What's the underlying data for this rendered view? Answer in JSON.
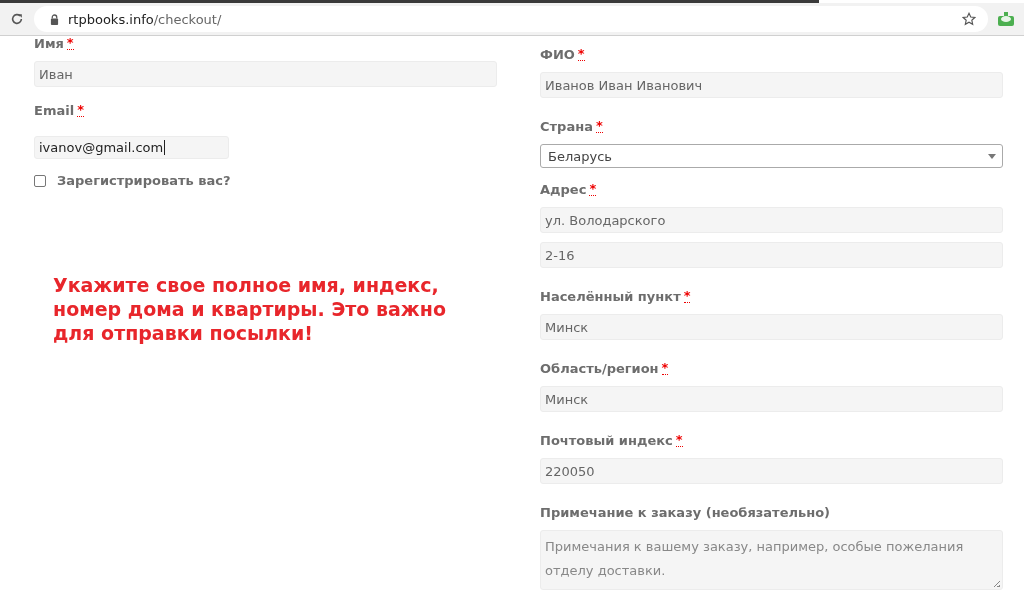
{
  "browser": {
    "url_host": "rtpbooks.info",
    "url_path": "/checkout/"
  },
  "left_fields": [
    {
      "label": "Имя",
      "required_mark": "*",
      "value": "Иван",
      "wide": true,
      "focused": false
    },
    {
      "label": "Email",
      "required_mark": "*",
      "value": "ivanov@gmail.com",
      "wide": false,
      "focused": true
    }
  ],
  "register": {
    "label": "Зарегистрировать вас?",
    "checked": false
  },
  "notice": "Укажите свое полное имя, индекс, номер дома и квартиры. Это важно для отправки посылки!",
  "right_fields": [
    {
      "kind": "text",
      "label": "ФИО",
      "required_mark": "*",
      "values": [
        "Иванов Иван Иванович"
      ]
    },
    {
      "kind": "select",
      "label": "Страна",
      "required_mark": "*",
      "values": [
        "Беларусь"
      ]
    },
    {
      "kind": "text",
      "label": "Адрес",
      "required_mark": "*",
      "values": [
        "ул. Володарского",
        "2-16"
      ]
    },
    {
      "kind": "text",
      "label": "Населённый пункт",
      "required_mark": "*",
      "values": [
        "Минск"
      ]
    },
    {
      "kind": "text",
      "label": "Область/регион ",
      "required_mark": "*",
      "values": [
        "Минск"
      ]
    },
    {
      "kind": "text",
      "label": "Почтовый индекс",
      "required_mark": "*",
      "values": [
        "220050"
      ]
    },
    {
      "kind": "textarea",
      "label": "Примечание к заказу (необязательно)",
      "placeholder": "Примечания к вашему заказу, например, особые пожелания отделу доставки."
    }
  ]
}
